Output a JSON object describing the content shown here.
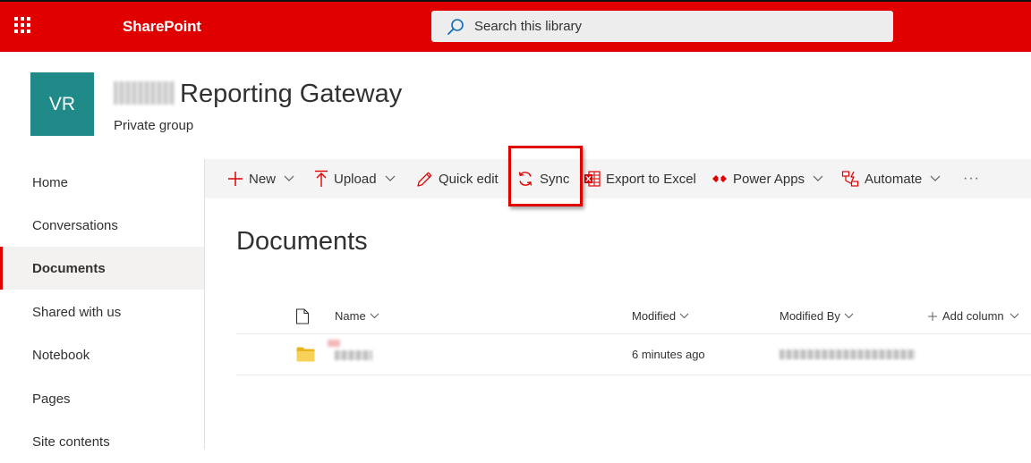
{
  "suite": {
    "app_name": "SharePoint",
    "search_placeholder": "Search this library",
    "bar_color": "#e00000"
  },
  "site": {
    "logo_text": "VR",
    "logo_color": "#1f8a87",
    "title": "Reporting Gateway",
    "subtitle": "Private group"
  },
  "nav": {
    "items": [
      {
        "label": "Home"
      },
      {
        "label": "Conversations"
      },
      {
        "label": "Documents",
        "active": true
      },
      {
        "label": "Shared with us"
      },
      {
        "label": "Notebook"
      },
      {
        "label": "Pages"
      },
      {
        "label": "Site contents"
      }
    ]
  },
  "commands": {
    "new": "New",
    "upload": "Upload",
    "quick_edit": "Quick edit",
    "sync": "Sync",
    "export": "Export to Excel",
    "power_apps": "Power Apps",
    "automate": "Automate",
    "more": "···",
    "icon_color": "#e00000"
  },
  "library": {
    "title": "Documents",
    "columns": {
      "name": "Name",
      "modified": "Modified",
      "modified_by": "Modified By",
      "add_column": "Add column"
    },
    "rows": [
      {
        "type": "folder",
        "modified": "6 minutes ago"
      }
    ]
  }
}
